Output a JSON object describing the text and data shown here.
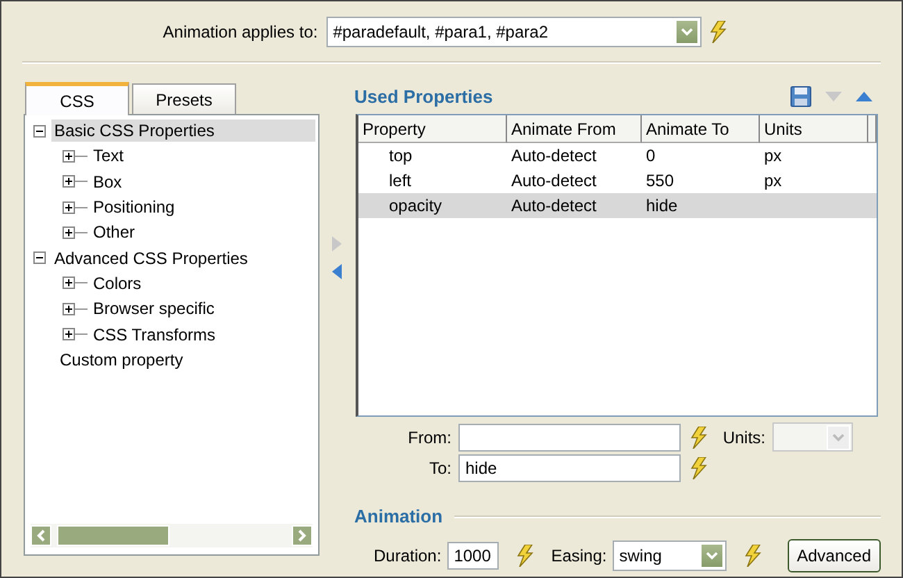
{
  "applies_to": {
    "label": "Animation applies to:",
    "value": "#paradefault, #para1, #para2"
  },
  "tabs": [
    {
      "label": "CSS",
      "selected": true
    },
    {
      "label": "Presets",
      "selected": false
    }
  ],
  "tree": [
    {
      "label": "Basic CSS Properties",
      "kind": "group",
      "expanded": true,
      "selected": true,
      "children": [
        {
          "label": "Text",
          "kind": "group",
          "expanded": false,
          "selected": false
        },
        {
          "label": "Box",
          "kind": "group",
          "expanded": false,
          "selected": false
        },
        {
          "label": "Positioning",
          "kind": "group",
          "expanded": false,
          "selected": false
        },
        {
          "label": "Other",
          "kind": "group",
          "expanded": false,
          "selected": false
        }
      ]
    },
    {
      "label": "Advanced CSS Properties",
      "kind": "group",
      "expanded": true,
      "selected": false,
      "children": [
        {
          "label": "Colors",
          "kind": "group",
          "expanded": false,
          "selected": false
        },
        {
          "label": "Browser specific",
          "kind": "group",
          "expanded": false,
          "selected": false
        },
        {
          "label": "CSS Transforms",
          "kind": "group",
          "expanded": false,
          "selected": false
        }
      ]
    },
    {
      "label": "Custom property",
      "kind": "leaf",
      "selected": false
    }
  ],
  "used_properties": {
    "title": "Used Properties",
    "columns": [
      "Property",
      "Animate From",
      "Animate To",
      "Units"
    ],
    "rows": [
      {
        "cells": [
          "top",
          "Auto-detect",
          "0",
          "px"
        ],
        "selected": false
      },
      {
        "cells": [
          "left",
          "Auto-detect",
          "550",
          "px"
        ],
        "selected": false
      },
      {
        "cells": [
          "opacity",
          "Auto-detect",
          "hide"
        ],
        "selected": true
      }
    ]
  },
  "from": {
    "label": "From:"
  },
  "units": {
    "label": "Units:",
    "disabled": true
  },
  "to": {
    "label": "To:",
    "value": "hide"
  },
  "animation": {
    "title": "Animation",
    "duration": {
      "label": "Duration:",
      "value": "1000"
    },
    "easing": {
      "label": "Easing:",
      "value": "swing"
    },
    "advanced_button": "Advanced"
  }
}
